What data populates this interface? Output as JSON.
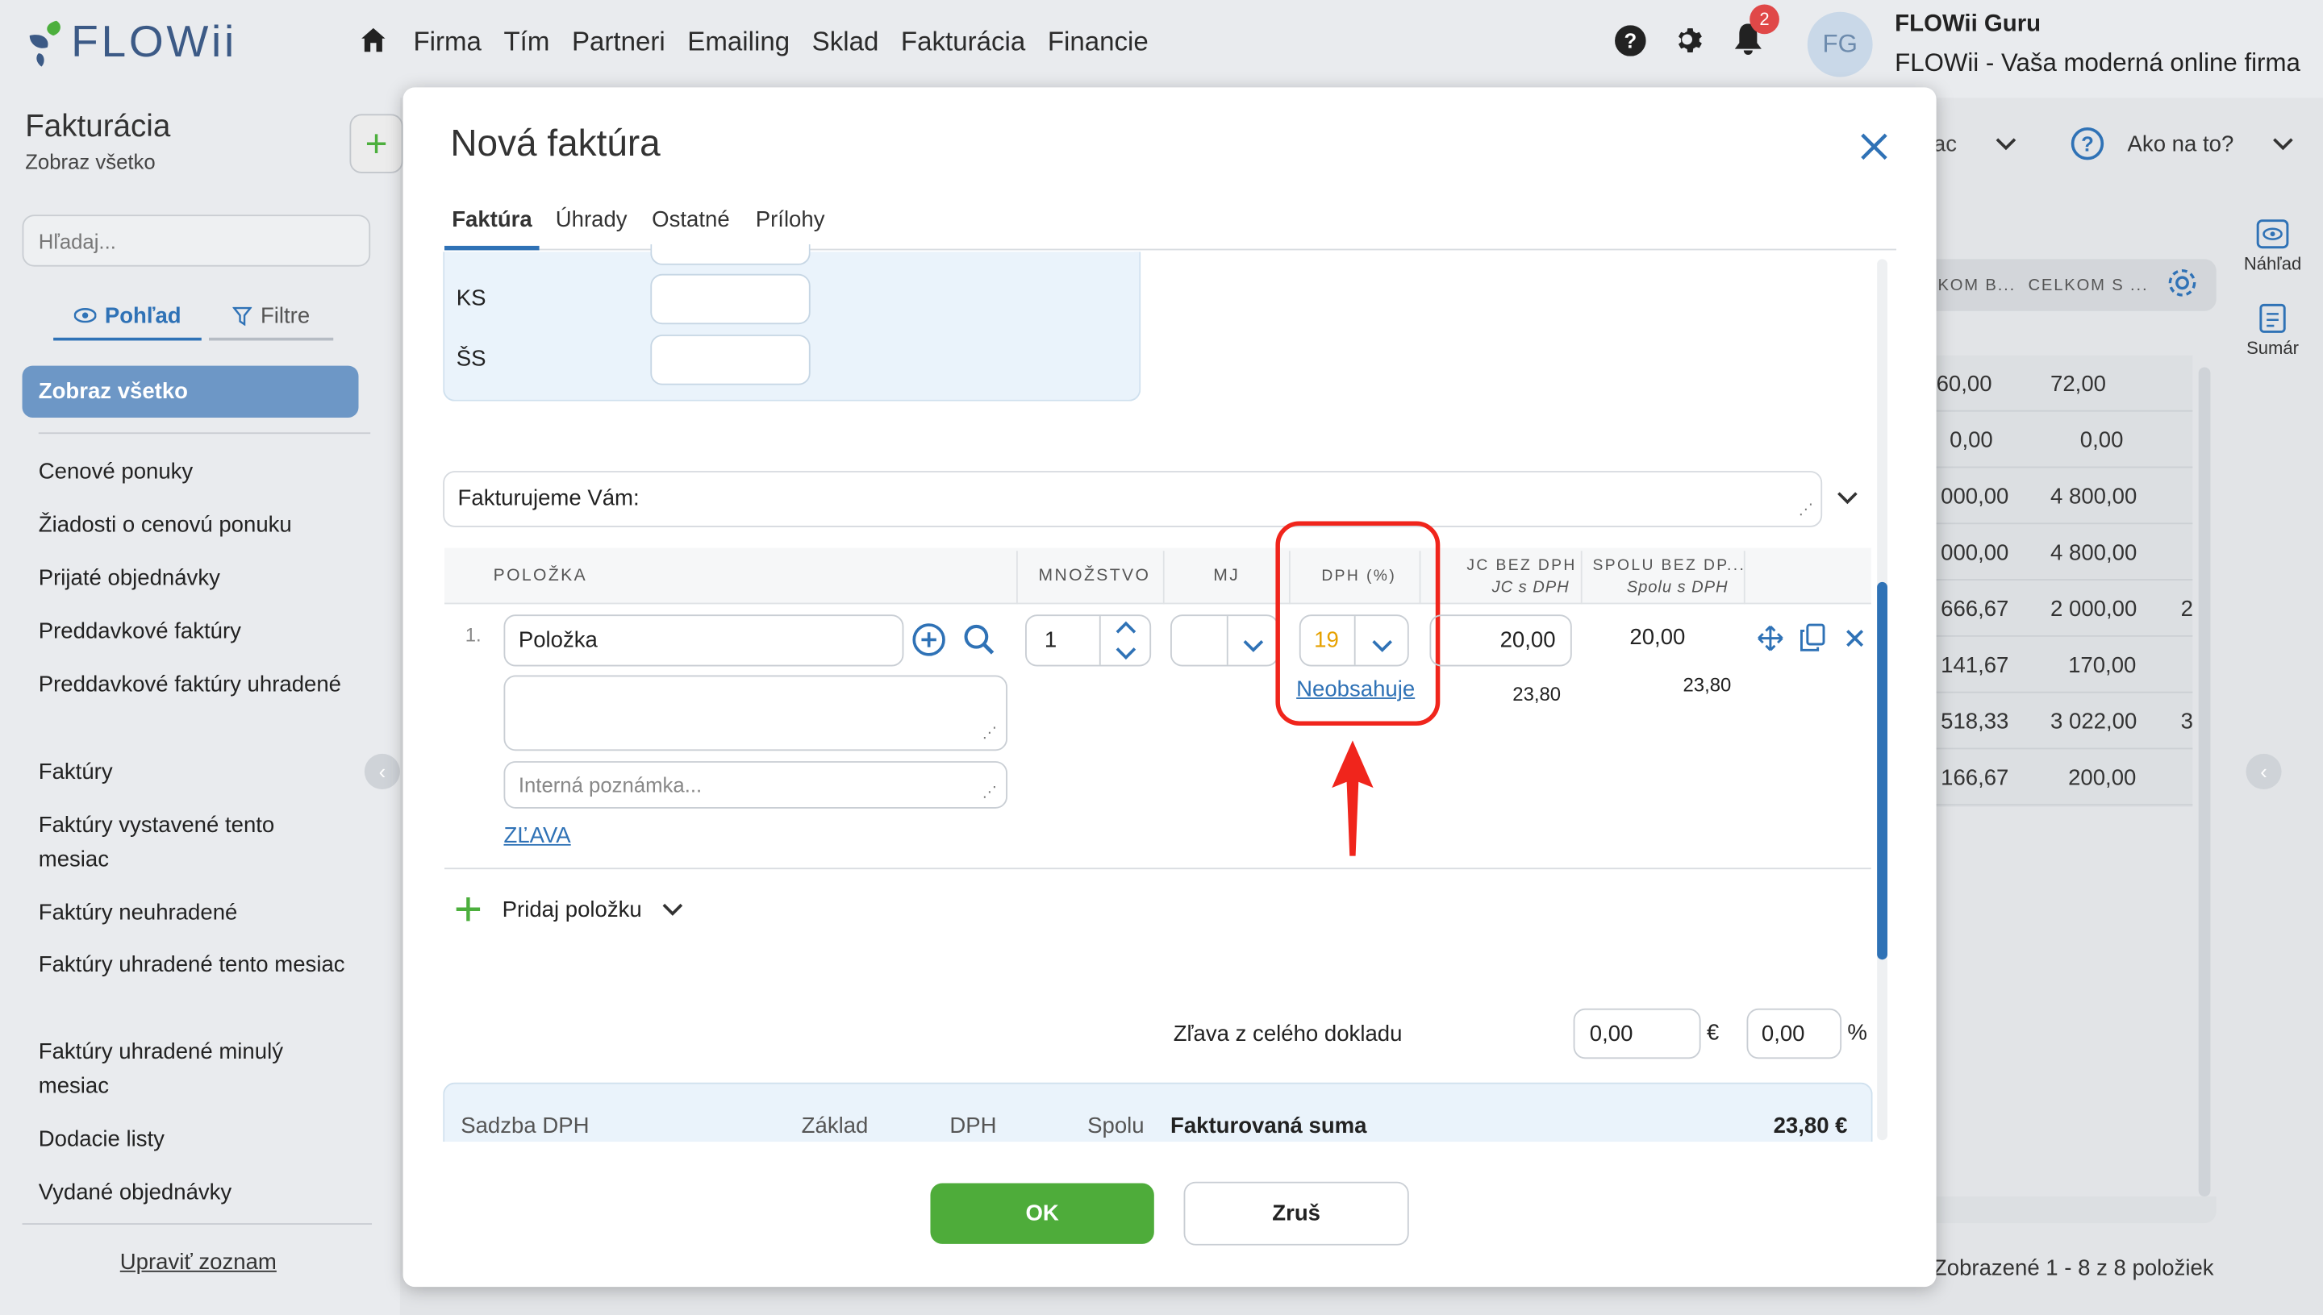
{
  "app": {
    "logo_text": "FLOWii"
  },
  "nav": {
    "items": [
      "Firma",
      "Tím",
      "Partneri",
      "Emailing",
      "Sklad",
      "Fakturácia",
      "Financie"
    ]
  },
  "topbar": {
    "notifications_count": "2",
    "avatar_initials": "FG",
    "user_name": "FLOWii Guru",
    "firm_name": "FLOWii - Vaša moderná online firma"
  },
  "sidebar": {
    "title": "Fakturácia",
    "subtitle": "Zobraz všetko",
    "search_placeholder": "Hľadaj...",
    "tab_view": "Pohľad",
    "tab_filter": "Filtre",
    "active_item": "Zobraz všetko",
    "items": [
      "Cenové ponuky",
      "Žiadosti o cenovú ponuku",
      "Prijaté objednávky",
      "Preddavkové faktúry",
      "Preddavkové faktúry uhradené",
      "Faktúry",
      "Faktúry vystavené tento mesiac",
      "Faktúry neuhradené",
      "Faktúry uhradené tento mesiac",
      "Faktúry uhradené minulý mesiac",
      "Dodacie listy",
      "Vydané objednávky"
    ],
    "edit_link": "Upraviť zoznam"
  },
  "background": {
    "month_label": "ac",
    "howto_label": "Ako na to?",
    "col_headers": [
      "KOM B...",
      "CELKOM S ..."
    ],
    "rows": [
      [
        "60,00",
        "72,00",
        ""
      ],
      [
        "0,00",
        "0,00",
        ""
      ],
      [
        "000,00",
        "4 800,00",
        ""
      ],
      [
        "000,00",
        "4 800,00",
        ""
      ],
      [
        "666,67",
        "2 000,00",
        "2"
      ],
      [
        "141,67",
        "170,00",
        ""
      ],
      [
        "518,33",
        "3 022,00",
        "3"
      ],
      [
        "166,67",
        "200,00",
        ""
      ]
    ],
    "preview_label": "Náhľad",
    "sum_label": "Sumár",
    "footer": "Zobrazené 1 - 8 z 8 položiek"
  },
  "modal": {
    "title": "Nová faktúra",
    "tabs": [
      "Faktúra",
      "Úhrady",
      "Ostatné",
      "Prílohy"
    ],
    "symbols": [
      {
        "label": "KS",
        "value": ""
      },
      {
        "label": "ŠS",
        "value": ""
      }
    ],
    "invoice_text": "Fakturujeme Vám:",
    "table": {
      "headers": {
        "item": "POLOŽKA",
        "qty": "MNOŽSTVO",
        "unit": "MJ",
        "vat": "DPH (%)",
        "unit_price": "JC BEZ DPH",
        "unit_price_sub": "JC s DPH",
        "total": "SPOLU BEZ DP...",
        "total_sub": "Spolu s DPH"
      },
      "row": {
        "number": "1.",
        "item": "Položka",
        "description": "",
        "note_placeholder": "Interná poznámka...",
        "discount_link": "ZĽAVA",
        "qty": "1",
        "unit": "",
        "vat": "19",
        "vat_link": "Neobsahuje",
        "unit_price": "20,00",
        "unit_price_vat": "23,80",
        "total": "20,00",
        "total_vat": "23,80"
      }
    },
    "add_item_label": "Pridaj položku",
    "doc_discount": {
      "label": "Zľava z celého dokladu",
      "eur_value": "0,00",
      "eur_symbol": "€",
      "pct_value": "0,00",
      "pct_symbol": "%"
    },
    "summary": {
      "rate_label": "Sadzba DPH",
      "base_label": "Základ",
      "vat_label": "DPH",
      "total_label": "Spolu",
      "invoiced_label": "Fakturovaná suma",
      "invoiced_value": "23,80 €"
    },
    "ok_label": "OK",
    "cancel_label": "Zruš"
  },
  "colors": {
    "accent": "#2f72b6",
    "ok_green": "#4eac3a",
    "highlight_red": "#f0251c",
    "vat_orange": "#e6a100"
  }
}
